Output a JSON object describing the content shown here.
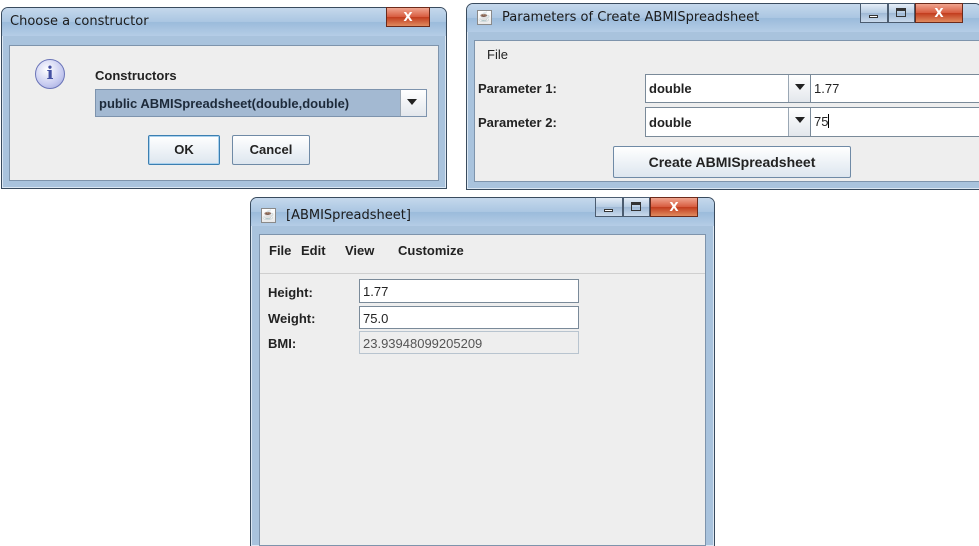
{
  "dialog_constructor": {
    "title": "Choose a constructor",
    "close_label": "X",
    "heading": "Constructors",
    "selected_constructor": "public ABMISpreadsheet(double,double)",
    "ok_label": "OK",
    "cancel_label": "Cancel",
    "info_icon": "info-icon"
  },
  "dialog_parameters": {
    "title": "Parameters of Create  ABMISpreadsheet",
    "close_label": "X",
    "menu": [
      "File"
    ],
    "rows": [
      {
        "label": "Parameter 1:",
        "type": "double",
        "value": "1.77"
      },
      {
        "label": "Parameter 2:",
        "type": "double",
        "value": "75"
      }
    ],
    "create_label": "Create  ABMISpreadsheet"
  },
  "main_window": {
    "title": "[ABMISpreadsheet]",
    "close_label": "X",
    "menu": [
      "File",
      "Edit",
      "View",
      "Customize"
    ],
    "fields": [
      {
        "label": "Height:",
        "value": "1.77"
      },
      {
        "label": "Weight:",
        "value": "75.0"
      },
      {
        "label": "BMI:",
        "value": "23.93948099205209"
      }
    ]
  },
  "colors": {
    "frame": "#a9c3dd",
    "client": "#eeeeee",
    "selection": "#a3b9d2",
    "close_button": "#c23c1e"
  }
}
